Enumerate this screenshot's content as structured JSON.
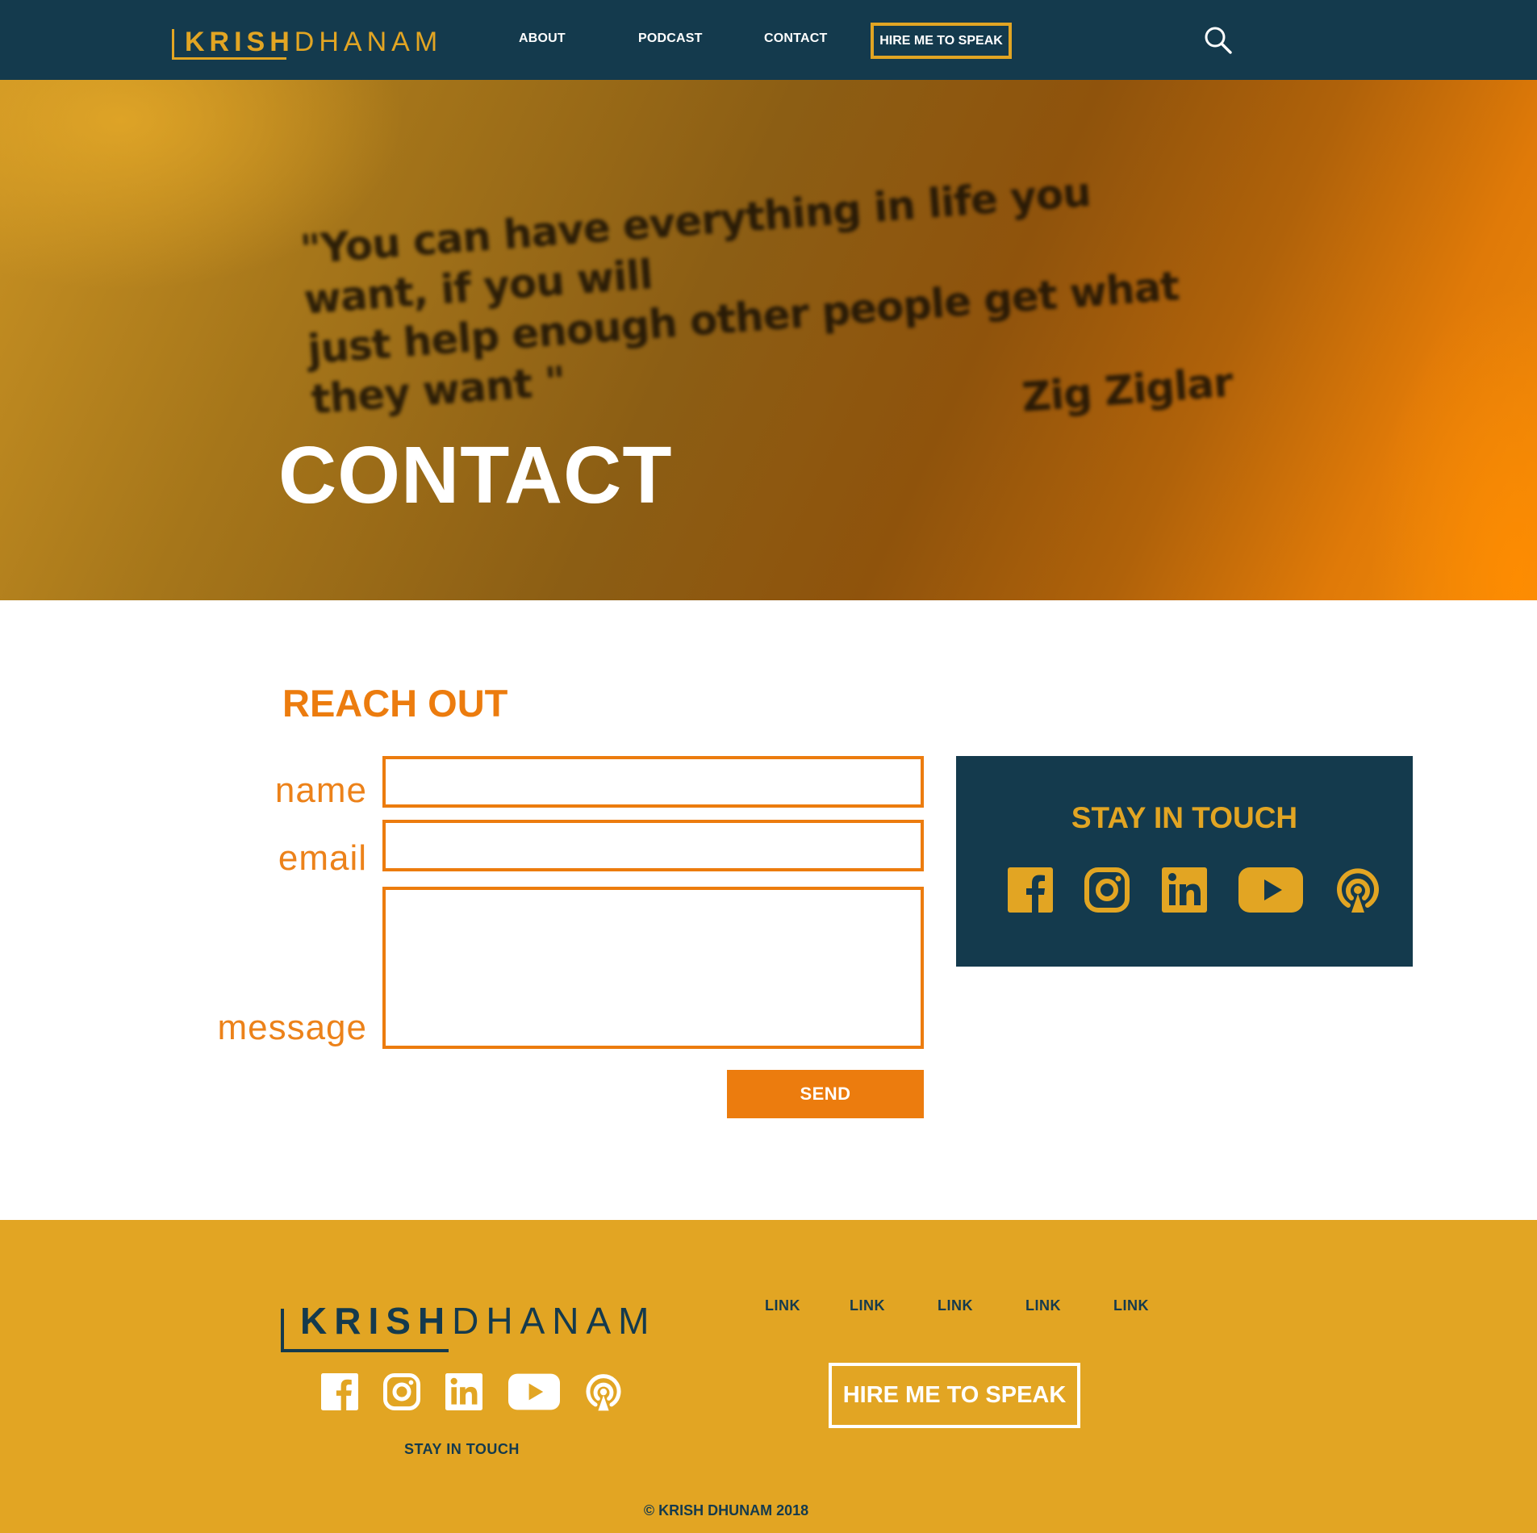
{
  "brand": {
    "name_bold": "KRISH",
    "name_light": "DHANAM",
    "colors": {
      "navy": "#143a4d",
      "gold": "#e2a523",
      "orange": "#ec7c0e",
      "white": "#ffffff"
    }
  },
  "header": {
    "nav": [
      {
        "label": "ABOUT"
      },
      {
        "label": "PODCAST"
      },
      {
        "label": "CONTACT"
      }
    ],
    "cta_label": "HIRE ME TO SPEAK",
    "search_icon": "search-icon"
  },
  "hero": {
    "quote_line1": "\"You can have everything in life you want, if you will",
    "quote_line2": "just help enough other people get what they want \"",
    "quote_author": "Zig Ziglar",
    "title": "CONTACT"
  },
  "form": {
    "title": "REACH OUT",
    "name_label": "name",
    "name_value": "",
    "email_label": "email",
    "email_value": "",
    "message_label": "message",
    "message_value": "",
    "send_label": "SEND"
  },
  "stay_in_touch": {
    "title": "STAY IN TOUCH",
    "icons": [
      "facebook-icon",
      "instagram-icon",
      "linkedin-icon",
      "youtube-icon",
      "podcast-icon"
    ]
  },
  "footer": {
    "links": [
      "LINK",
      "LINK",
      "LINK",
      "LINK",
      "LINK"
    ],
    "cta_label": "HIRE ME TO SPEAK",
    "stay_label": "STAY IN TOUCH",
    "icons": [
      "facebook-icon",
      "instagram-icon",
      "linkedin-icon",
      "youtube-icon",
      "podcast-icon"
    ],
    "copyright": "© KRISH DHUNAM 2018"
  }
}
